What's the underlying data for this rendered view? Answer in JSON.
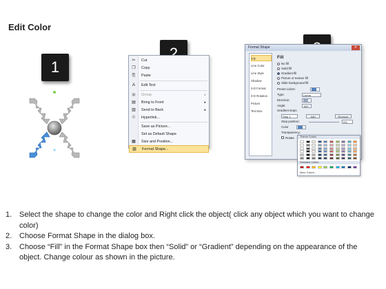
{
  "title": "Edit Color",
  "badges": [
    "1",
    "2",
    "3"
  ],
  "context_menu": {
    "items": [
      {
        "label": "Cut",
        "icon": "scissors-icon",
        "glyph": "✂",
        "disabled": false,
        "submenu": false
      },
      {
        "label": "Copy",
        "icon": "copy-icon",
        "glyph": "❐",
        "disabled": false,
        "submenu": false
      },
      {
        "label": "Paste",
        "icon": "paste-icon",
        "glyph": "⎘",
        "disabled": false,
        "submenu": false
      },
      {
        "label": "Edit Text",
        "icon": "text-icon",
        "glyph": "A",
        "disabled": false,
        "submenu": false
      },
      {
        "label": "Group",
        "icon": "group-icon",
        "glyph": "▣",
        "disabled": true,
        "submenu": true
      },
      {
        "label": "Bring to Front",
        "icon": "bring-front-icon",
        "glyph": "▤",
        "disabled": false,
        "submenu": true
      },
      {
        "label": "Send to Back",
        "icon": "send-back-icon",
        "glyph": "▥",
        "disabled": false,
        "submenu": true
      },
      {
        "label": "Hyperlink...",
        "icon": "hyperlink-icon",
        "glyph": "☉",
        "disabled": false,
        "submenu": false
      },
      {
        "label": "Save as Picture...",
        "icon": "",
        "glyph": "",
        "disabled": false,
        "submenu": false
      },
      {
        "label": "Set as Default Shape",
        "icon": "",
        "glyph": "",
        "disabled": false,
        "submenu": false
      },
      {
        "label": "Size and Position...",
        "icon": "size-icon",
        "glyph": "▦",
        "disabled": false,
        "submenu": false
      },
      {
        "label": "Format Shape...",
        "icon": "format-shape-icon",
        "glyph": "▧",
        "disabled": false,
        "submenu": false
      }
    ]
  },
  "format_dialog": {
    "title": "Format Shape",
    "left_items": [
      "Fill",
      "Line Color",
      "Line Style",
      "Shadow",
      "3-D Format",
      "3-D Rotation",
      "Picture",
      "Text Box"
    ],
    "fill_heading": "Fill",
    "options": [
      "No fill",
      "Solid fill",
      "Gradient fill",
      "Picture or texture fill",
      "Slide background fill"
    ],
    "selected_option": "Gradient fill",
    "fields": {
      "preset_colors": "Preset colors:",
      "type": "Type:",
      "type_value": "Linear",
      "direction": "Direction:",
      "angle": "Angle:",
      "angle_value": "180°",
      "gradient_stops": "Gradient stops",
      "stop": "Stop 1",
      "add": "Add",
      "remove": "Remove",
      "stop_position": "Stop position:",
      "stop_position_value": "0%",
      "color": "Color",
      "transparency": "Transparency:",
      "rotate": "Rotate"
    }
  },
  "palette": {
    "theme_label": "Theme Colors",
    "standard_label": "Standard Colors",
    "more_label": "More Colors...",
    "theme_colors": [
      "#ffffff",
      "#000000",
      "#eeece1",
      "#1f497d",
      "#4f81bd",
      "#c0504d",
      "#9bbb59",
      "#8064a2",
      "#4bacc6",
      "#f79646"
    ],
    "standard_colors": [
      "#c00000",
      "#ff0000",
      "#ffc000",
      "#ffff00",
      "#92d050",
      "#00b050",
      "#00b0f0",
      "#0070c0",
      "#002060",
      "#7030a0"
    ],
    "accent_color": "#2c58b0"
  },
  "steps": [
    {
      "num": "1.",
      "text": "Select the shape to change the color and Right click the object( click any object which you want to change color)"
    },
    {
      "num": "2.",
      "text": "Choose Format Shape in the dialog box."
    },
    {
      "num": "3.",
      "text": "Choose “Fill” in the Format Shape box then “Solid” or “Gradient” depending on the appearance of the object. Change colour as shown in the picture."
    }
  ]
}
